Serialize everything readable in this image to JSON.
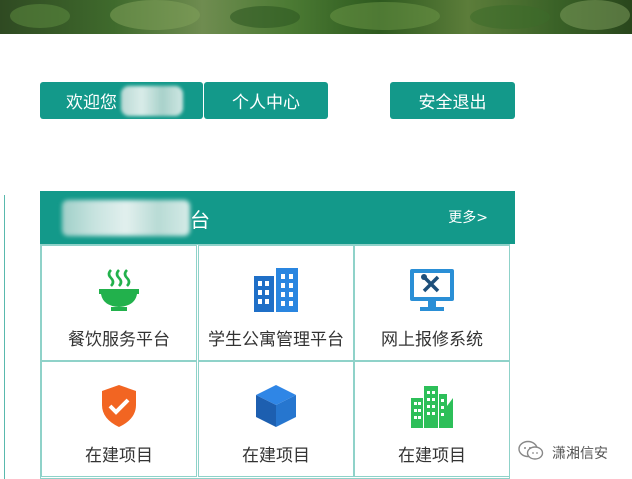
{
  "header": {
    "welcome_label": "欢迎您",
    "personal_center_label": "个人中心",
    "logout_label": "安全退出"
  },
  "panel": {
    "title_suffix": "台",
    "more_label": "更多>"
  },
  "services": [
    {
      "label": "餐饮服务平台",
      "icon": "bowl-icon"
    },
    {
      "label": "学生公寓管理平台",
      "icon": "apartment-building-icon"
    },
    {
      "label": "网上报修系统",
      "icon": "repair-monitor-icon"
    },
    {
      "label": "在建项目",
      "icon": "shield-check-icon"
    },
    {
      "label": "在建项目",
      "icon": "cube-icon"
    },
    {
      "label": "在建项目",
      "icon": "city-buildings-icon"
    }
  ],
  "watermark": {
    "text": "潇湘信安",
    "icon": "wechat-icon"
  },
  "colors": {
    "accent": "#13998a",
    "border": "#8fd2c9",
    "bowl_green": "#22b14c",
    "building_blue": "#1f6fc7",
    "monitor_blue": "#2a8fd6",
    "shield_orange": "#f26522",
    "city_green": "#2dbf59"
  }
}
